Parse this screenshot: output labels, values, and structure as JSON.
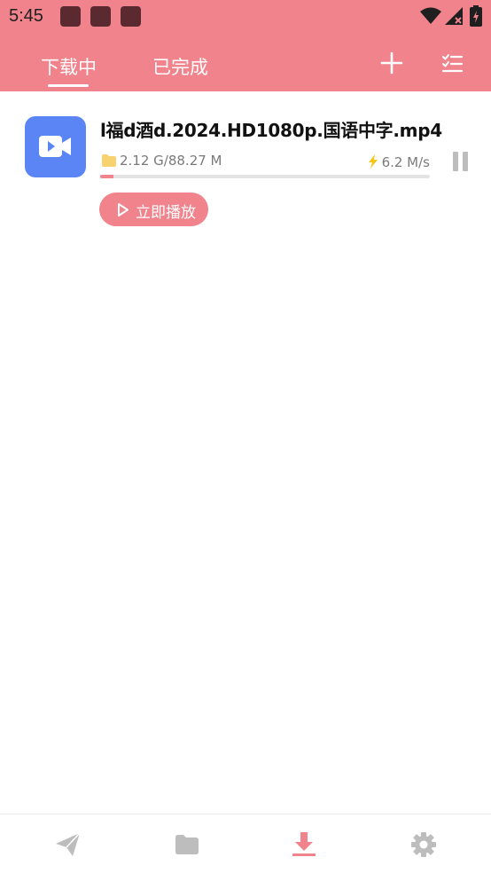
{
  "status_bar": {
    "time": "5:45",
    "notification_icons": [
      "app-notification-icon",
      "app-notification-icon",
      "app-notification-icon"
    ],
    "system_icons": [
      "wifi-icon",
      "signal-icon",
      "battery-icon"
    ]
  },
  "header": {
    "tabs": [
      {
        "label": "下载中",
        "active": true
      },
      {
        "label": "已完成",
        "active": false
      }
    ],
    "actions": [
      "add-icon",
      "checklist-icon"
    ]
  },
  "downloads": [
    {
      "file_name": "l福d酒d.2024.HD1080p.国语中字.mp4",
      "size_text": "2.12 G/88.27 M",
      "speed_text": "6.2 M/s",
      "progress_fraction": 0.04,
      "play_button_label": "立即播放",
      "icon": "video-camera-icon"
    }
  ],
  "bottom_nav": {
    "items": [
      "send-icon",
      "folder-icon",
      "download-icon",
      "settings-icon"
    ],
    "active": "download-icon"
  },
  "colors": {
    "accent": "#f0838c",
    "thumb_bg": "#5b85f5",
    "inactive_icon": "#bdbdbd"
  }
}
